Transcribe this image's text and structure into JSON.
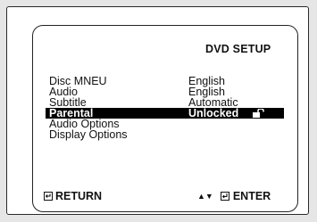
{
  "screen": {
    "title": "DVD SETUP",
    "menu": [
      {
        "label": "Disc MNEU",
        "value": "English",
        "selected": false
      },
      {
        "label": "Audio",
        "value": "English",
        "selected": false
      },
      {
        "label": "Subtitle",
        "value": "Automatic",
        "selected": false
      },
      {
        "label": "Parental",
        "value": "Unlocked",
        "selected": true,
        "icon": "unlocked-padlock-icon"
      },
      {
        "label": "Audio Options",
        "value": "",
        "selected": false
      },
      {
        "label": "Display Options",
        "value": "",
        "selected": false
      }
    ],
    "footer": {
      "return_label": "RETURN",
      "nav_arrows": "▲▼",
      "enter_label": "ENTER",
      "return_icon": "return-key-icon",
      "enter_icon": "enter-key-icon"
    }
  },
  "colors": {
    "highlight_bg": "#000000",
    "highlight_text": "#ffffff",
    "text": "#111111",
    "bezel": "#e6e6e6"
  }
}
